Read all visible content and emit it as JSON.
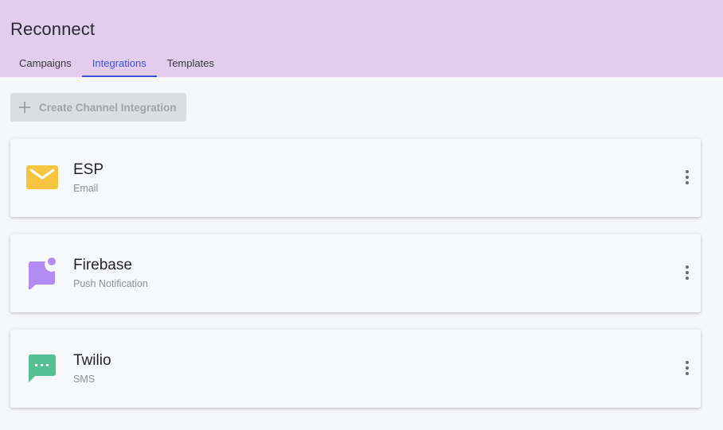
{
  "app": {
    "title": "Reconnect"
  },
  "tabs": [
    {
      "label": "Campaigns",
      "active": false
    },
    {
      "label": "Integrations",
      "active": true
    },
    {
      "label": "Templates",
      "active": false
    }
  ],
  "toolbar": {
    "create_label": "Create Channel Integration",
    "create_icon": "plus-icon"
  },
  "integrations": [
    {
      "name": "ESP",
      "type": "Email",
      "icon": "envelope-icon",
      "icon_color": "#f5c540"
    },
    {
      "name": "Firebase",
      "type": "Push Notification",
      "icon": "push-notification-icon",
      "icon_color": "#b18cf2"
    },
    {
      "name": "Twilio",
      "type": "SMS",
      "icon": "sms-chat-icon",
      "icon_color": "#55bf94"
    }
  ],
  "colors": {
    "header_bg": "#e2cdef",
    "accent": "#3f4fd8",
    "page_bg": "#f6f7f9"
  }
}
